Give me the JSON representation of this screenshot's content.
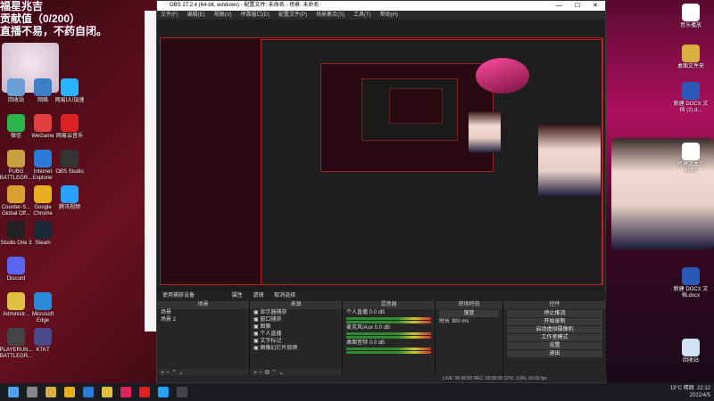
{
  "overlay": {
    "line1": "福星兆吉",
    "line2": "贡献值（0/200）",
    "line3": "直播不易，不药自闭。"
  },
  "desktop_left": [
    {
      "label": "回收站",
      "color": "#6aa0d8"
    },
    {
      "label": "网络",
      "color": "#3b7fc8"
    },
    {
      "label": "微信",
      "color": "#2ab44a"
    },
    {
      "label": "WeGame",
      "color": "#e04040"
    },
    {
      "label": "网易云音乐",
      "color": "#d22"
    },
    {
      "label": "PUBG BATTLEGR...",
      "color": "#c8a040"
    },
    {
      "label": "Internet Explorer",
      "color": "#2a7ad8"
    },
    {
      "label": "OBS Studio",
      "color": "#333"
    },
    {
      "label": "Counter-S... Global Off...",
      "color": "#d8a030"
    },
    {
      "label": "Google Chrome",
      "color": "#e8b020"
    },
    {
      "label": "腾讯视频",
      "color": "#2aa0ff"
    },
    {
      "label": "Studio One 3",
      "color": "#222"
    },
    {
      "label": "Steam",
      "color": "#1b2838"
    },
    {
      "label": "Discord",
      "color": "#5865f2"
    },
    {
      "label": "Administr...",
      "color": "#e0c040"
    },
    {
      "label": "Microsoft Edge",
      "color": "#2a8ad8"
    },
    {
      "label": "PLAYERUN... BATTLEGR...",
      "color": "#444"
    },
    {
      "label": "KTKT",
      "color": "#4a4a8a"
    },
    {
      "label": "网易UU加速",
      "color": "#2ab4ff"
    }
  ],
  "desktop_right": [
    {
      "label": "音乐播放",
      "color": "#ffffff"
    },
    {
      "label": "桌面文件夹",
      "color": "#d8b040"
    },
    {
      "label": "新建 DOCX 文档 (2).d...",
      "color": "#2a5ab8"
    },
    {
      "label": "新建文本文档.txt",
      "color": "#ffffff"
    },
    {
      "label": "新建 DOCX 文档.docx",
      "color": "#2a5ab8"
    },
    {
      "label": "回收站",
      "color": "#cfe3f4"
    }
  ],
  "obs": {
    "title": "OBS 27.2.4 (64-bit, windows) - 配置文件: 未命名 - 场景: 未命名",
    "menu": [
      "文件(F)",
      "编辑(E)",
      "视图(V)",
      "停靠窗口(D)",
      "配置文件(P)",
      "场景集合(S)",
      "工具(T)",
      "帮助(H)"
    ],
    "tabs": {
      "source_label": "使用捕获设备",
      "properties": "属性",
      "filters": "滤镜",
      "cancel": "取消选择"
    },
    "scenes": {
      "header": "场景",
      "items": [
        "场景",
        "场景 2"
      ]
    },
    "sources": {
      "header": "来源",
      "items": [
        "显示器捕获",
        "窗口捕获",
        "图像",
        "个人直播",
        "文字标记",
        "图像幻灯片放映"
      ]
    },
    "mixer": {
      "header": "混音器",
      "channels": [
        {
          "name": "个人直播",
          "db": "0.0 dB"
        },
        {
          "name": "麦克风/Aux",
          "db": "0.0 dB"
        },
        {
          "name": "桌面音频",
          "db": "0.0 dB"
        }
      ]
    },
    "transitions": {
      "header": "转场特效",
      "type": "渐变",
      "duration_label": "时长",
      "duration": "300 ms"
    },
    "controls": {
      "header": "控件",
      "buttons": [
        "停止推流",
        "开始录制",
        "启动虚拟摄像机",
        "工作室模式",
        "设置",
        "退出"
      ]
    },
    "status": "LIVE: 00:00:00   REC: 00:00:00   CPU: 3.9%, 60.00 fps"
  },
  "taskbar": {
    "weather": "13°C 晴朗",
    "time": "22:12",
    "date": "2022/4/5"
  }
}
